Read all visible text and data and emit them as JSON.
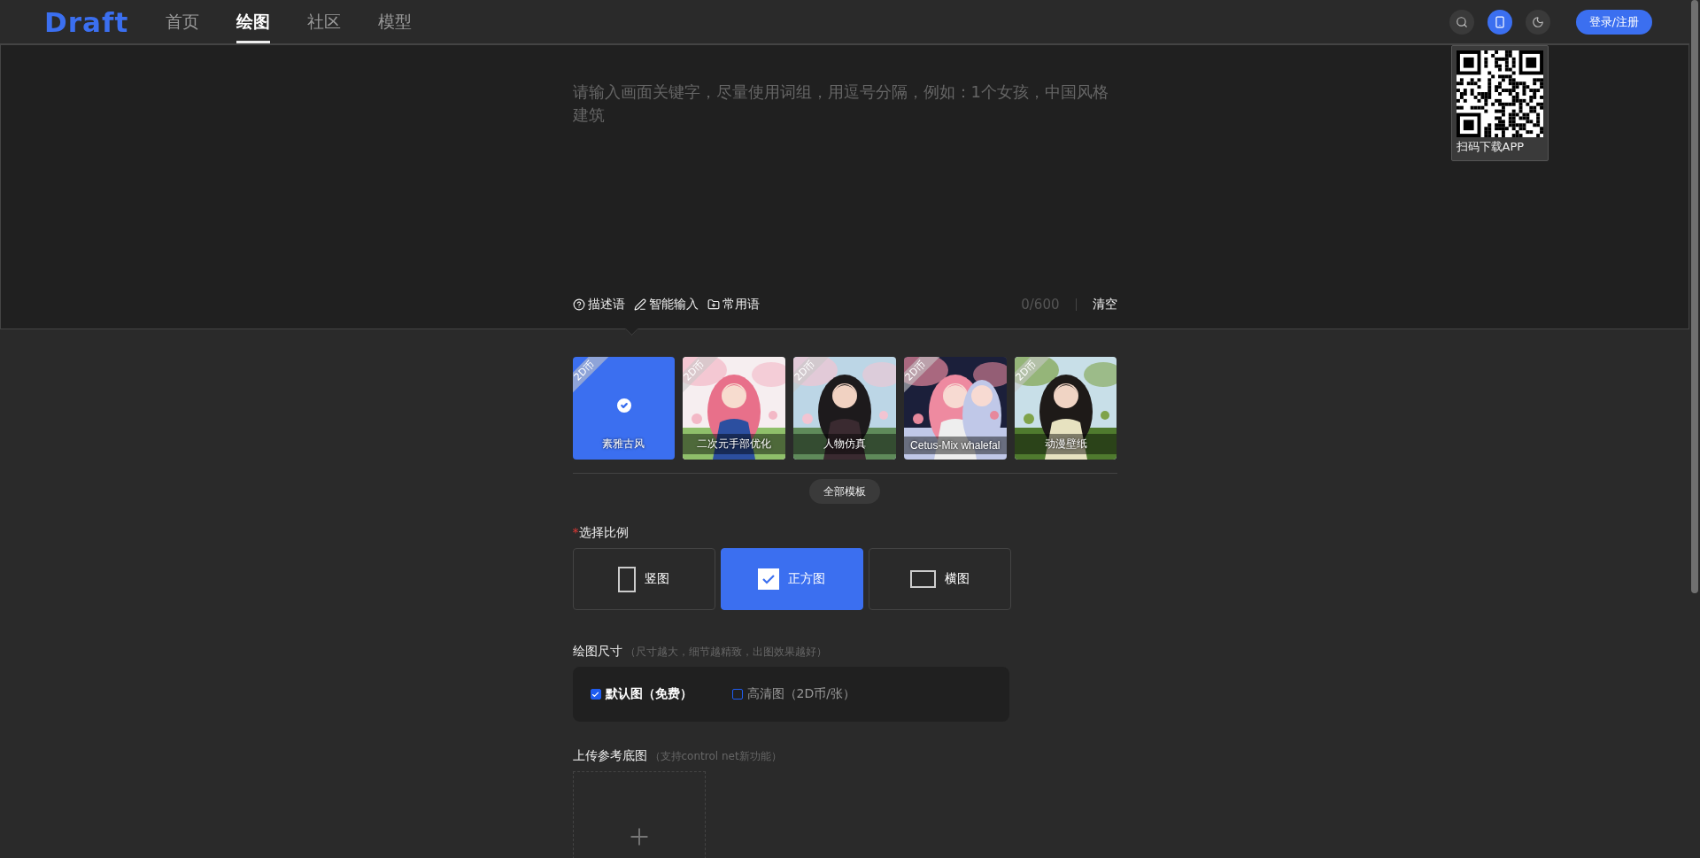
{
  "logo": "Draft",
  "nav": [
    {
      "label": "首页",
      "selected": false
    },
    {
      "label": "绘图",
      "selected": true
    },
    {
      "label": "社区",
      "selected": false
    },
    {
      "label": "模型",
      "selected": false
    }
  ],
  "icon_buttons": [
    {
      "kind": "search",
      "selected": false
    },
    {
      "kind": "phone",
      "selected": true
    },
    {
      "kind": "theme",
      "selected": false
    }
  ],
  "login": "登录/注册",
  "qr_popup": {
    "caption": "扫码下载APP"
  },
  "prompt": {
    "placeholder": "请输入画面关键字，尽量使用词组，用逗号分隔，例如：1个女孩，中国风格建筑",
    "tools": [
      {
        "kind": "help",
        "label": "描述语"
      },
      {
        "kind": "pen",
        "label": "智能输入"
      },
      {
        "kind": "folder",
        "label": "常用语"
      }
    ],
    "counter": "0/600",
    "clear": "清空"
  },
  "templates": [
    {
      "badge": "2D币",
      "label": "素雅古风",
      "selected": true
    },
    {
      "badge": "2D币",
      "label": "二次元手部优化",
      "selected": false
    },
    {
      "badge": "2D币",
      "label": "人物仿真",
      "selected": false
    },
    {
      "badge": "2D币",
      "label": "Cetus-Mix whalefal",
      "selected": false
    },
    {
      "badge": "2D币",
      "label": "动漫壁纸",
      "selected": false
    }
  ],
  "all_templates": "全部模板",
  "ratio": {
    "required_mark": "*",
    "label": "选择比例",
    "options": [
      {
        "kind": "portrait",
        "label": "竖图",
        "selected": false
      },
      {
        "kind": "square",
        "label": "正方图",
        "selected": true
      },
      {
        "kind": "landscape",
        "label": "横图",
        "selected": false
      }
    ]
  },
  "size": {
    "label": "绘图尺寸",
    "hint": "（尺寸越大，细节越精致，出图效果越好）",
    "options": [
      {
        "label": "默认图（免费）",
        "checked": true
      },
      {
        "label": "高清图（2D币/张）",
        "checked": false
      }
    ]
  },
  "upload": {
    "label": "上传参考底图",
    "hint": "（支持control net新功能）"
  }
}
